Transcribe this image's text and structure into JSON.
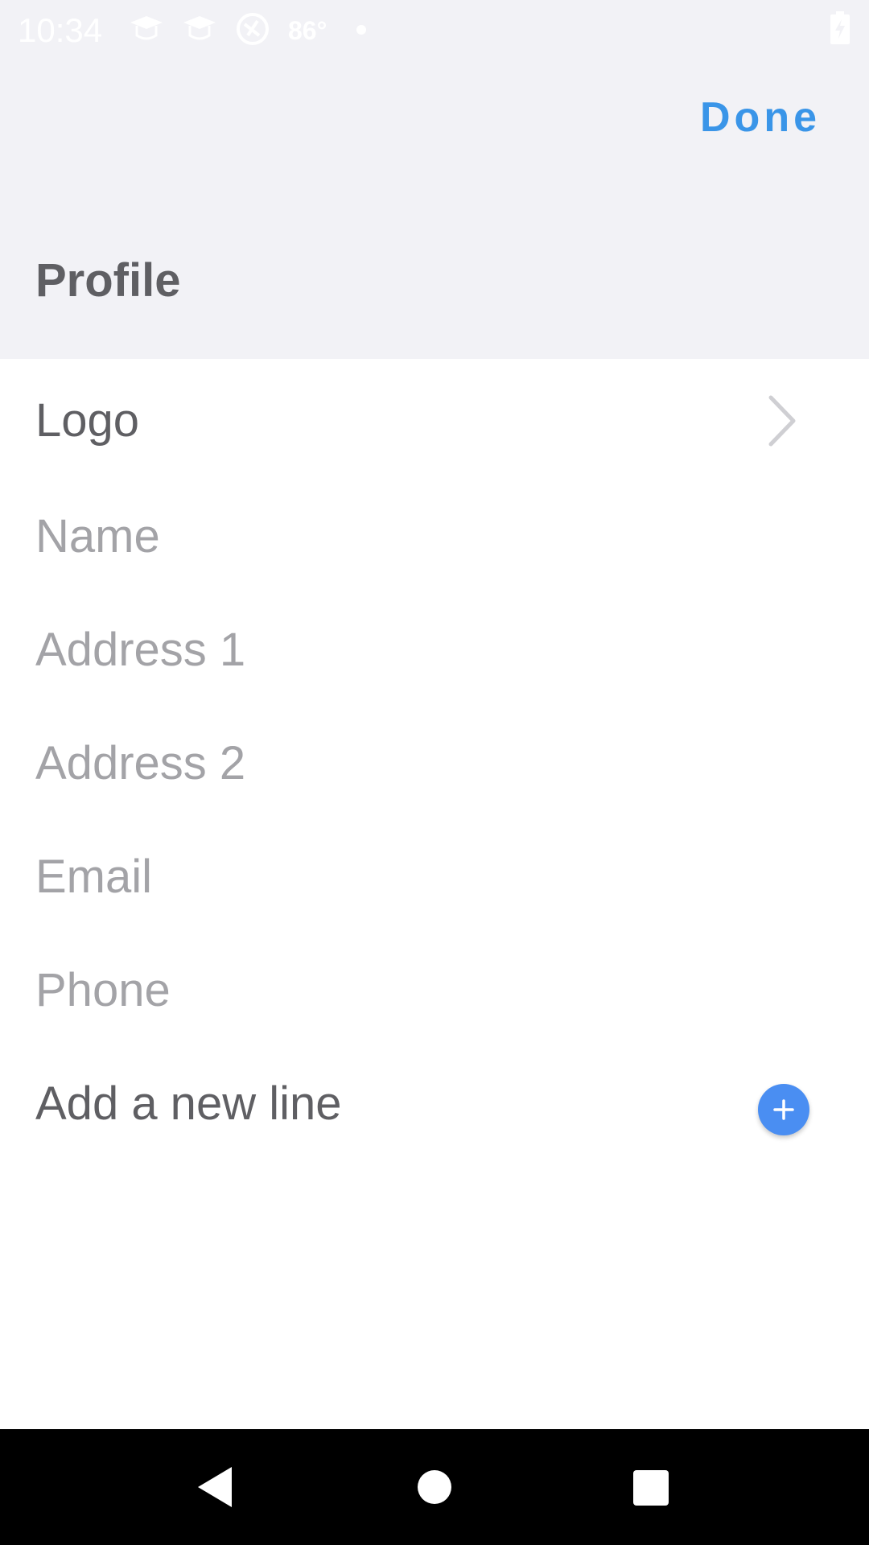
{
  "status_bar": {
    "time": "10:34",
    "temperature": "86°",
    "icons": [
      "graduation-cap-icon",
      "graduation-cap-icon",
      "circle-app-icon",
      "dot-icon",
      "battery-charging-icon"
    ]
  },
  "header": {
    "done_label": "Done",
    "section_title": "Profile"
  },
  "profile": {
    "logo_label": "Logo",
    "fields": [
      {
        "label": "Name"
      },
      {
        "label": "Address 1"
      },
      {
        "label": "Address 2"
      },
      {
        "label": "Email"
      },
      {
        "label": "Phone"
      }
    ],
    "add_line_label": "Add a new line"
  },
  "navigation": {
    "icons": [
      "back-icon",
      "home-icon",
      "recents-icon"
    ]
  },
  "colors": {
    "accent": "#3a95e8",
    "add_button": "#4a8ef2",
    "header_background": "#f2f2f6",
    "label_dark": "#5f5f63",
    "label_placeholder": "#a3a3a7"
  }
}
